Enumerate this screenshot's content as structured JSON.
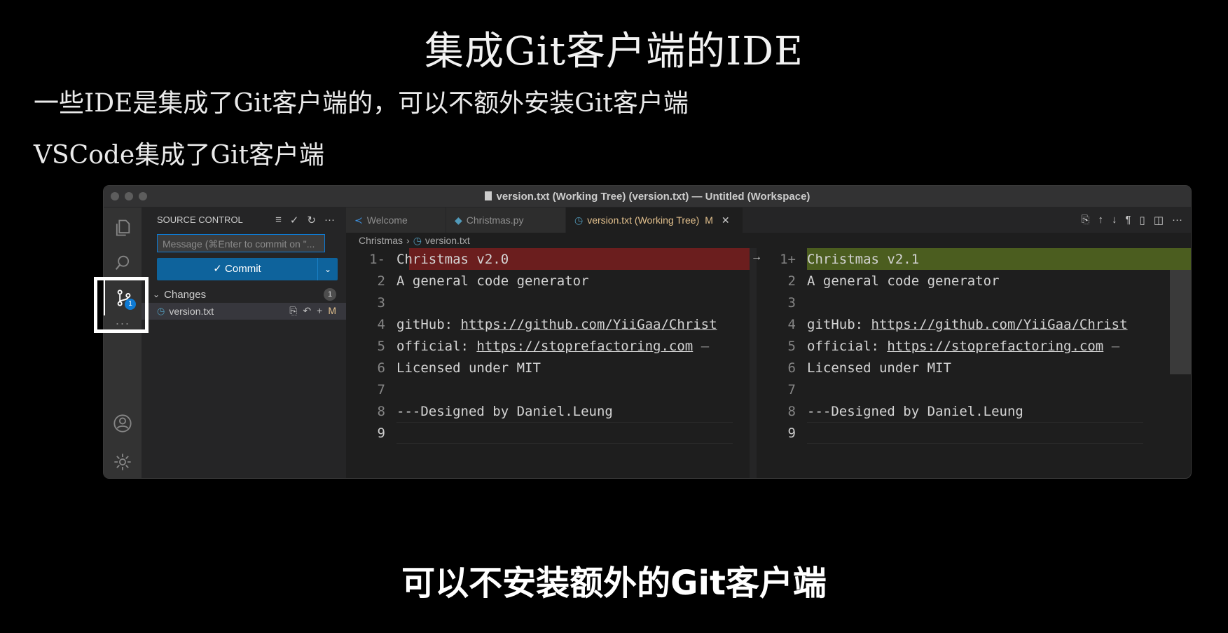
{
  "slide": {
    "title": "集成Git客户端的IDE",
    "bullets": [
      "一些IDE是集成了Git客户端的，可以不额外安装Git客户端",
      "VSCode集成了Git客户端"
    ],
    "subtitle": "可以不安装额外的Git客户端"
  },
  "window": {
    "title": "version.txt (Working Tree) (version.txt) — Untitled (Workspace)"
  },
  "activity_bar": {
    "icons": [
      "files-icon",
      "search-icon",
      "source-control-icon",
      "more-icon",
      "account-icon",
      "settings-icon"
    ],
    "scm_badge": "1",
    "more": "···"
  },
  "sidebar": {
    "header": "SOURCE CONTROL",
    "message_placeholder": "Message (⌘Enter to commit on \"...",
    "commit_label": "✓ Commit",
    "changes_label": "Changes",
    "changes_count": "1",
    "file": {
      "name": "version.txt",
      "status": "M"
    }
  },
  "tabs": [
    {
      "label": "Welcome"
    },
    {
      "label": "Christmas.py"
    },
    {
      "label": "version.txt (Working Tree)",
      "status": "M"
    }
  ],
  "breadcrumb": {
    "folder": "Christmas",
    "file": "version.txt"
  },
  "diff": {
    "left": [
      {
        "n": "1-",
        "text": "Christmas v2.0"
      },
      {
        "n": "2",
        "text": "A general code generator"
      },
      {
        "n": "3",
        "text": ""
      },
      {
        "n": "4",
        "prefix": "gitHub: ",
        "link": "https://github.com/YiiGaa/Christ"
      },
      {
        "n": "5",
        "prefix": "official: ",
        "link": "https://stoprefactoring.com",
        "suffix": " —"
      },
      {
        "n": "6",
        "text": "Licensed under MIT"
      },
      {
        "n": "7",
        "text": ""
      },
      {
        "n": "8",
        "text": "---Designed by Daniel.Leung"
      },
      {
        "n": "9",
        "text": ""
      }
    ],
    "right": [
      {
        "n": "1+",
        "text": "Christmas v2.1"
      },
      {
        "n": "2",
        "text": "A general code generator"
      },
      {
        "n": "3",
        "text": ""
      },
      {
        "n": "4",
        "prefix": "gitHub: ",
        "link": "https://github.com/YiiGaa/Christ"
      },
      {
        "n": "5",
        "prefix": "official: ",
        "link": "https://stoprefactoring.com",
        "suffix": " —"
      },
      {
        "n": "6",
        "text": "Licensed under MIT"
      },
      {
        "n": "7",
        "text": ""
      },
      {
        "n": "8",
        "text": "---Designed by Daniel.Leung"
      },
      {
        "n": "9",
        "text": ""
      }
    ]
  },
  "colors": {
    "removed": "#6b1e1e",
    "added": "#4b5d1f",
    "accent": "#0e639c"
  }
}
